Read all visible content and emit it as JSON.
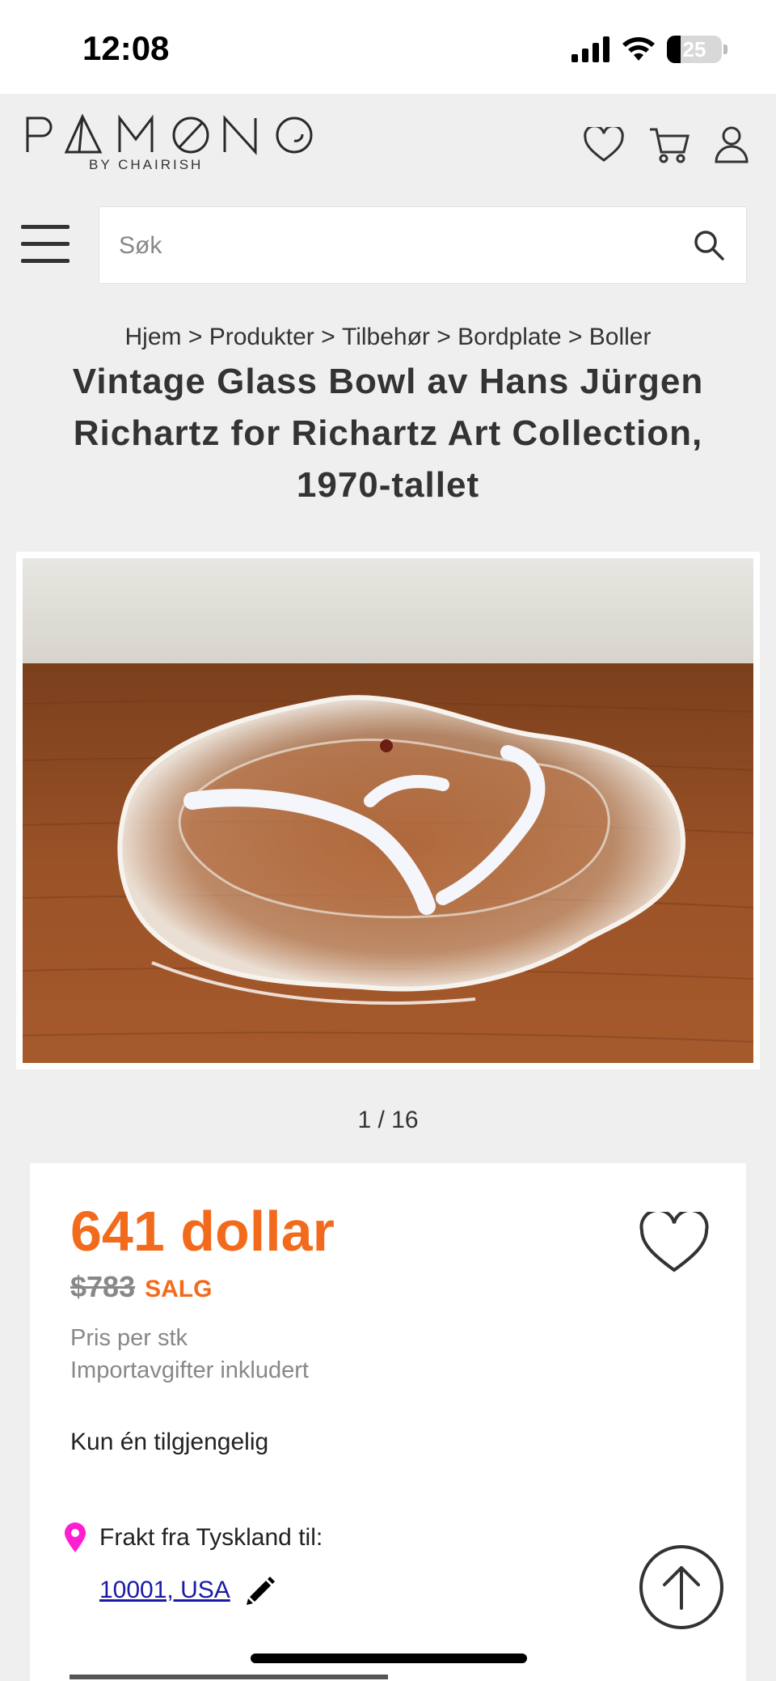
{
  "status_bar": {
    "time": "12:08",
    "battery_level": "25",
    "battery_fraction": 0.25
  },
  "header": {
    "logo_text": "PAMONO",
    "logo_subtitle": "BY CHAIRISH",
    "icons": [
      "heart-icon",
      "cart-icon",
      "user-icon"
    ]
  },
  "search": {
    "placeholder": "Søk",
    "value": ""
  },
  "breadcrumb": [
    "Hjem",
    "Produkter",
    "Tilbehør",
    "Bordplate",
    "Boller"
  ],
  "breadcrumb_separator": ">",
  "product": {
    "title": "Vintage Glass Bowl av Hans Jürgen Richartz for Richartz Art Collection, 1970-tallet",
    "image_counter": "1 / 16",
    "price": "641 dollar",
    "old_price": "$783",
    "sale_label": "SALG",
    "price_note_1": "Pris per stk",
    "price_note_2": "Importavgifter inkludert",
    "availability": "Kun én tilgjengelig",
    "shipping_label": "Frakt fra Tyskland til:",
    "shipping_destination": "10001, USA"
  },
  "colors": {
    "accent": "#f26b1d",
    "location_pin": "#ff1fd1",
    "link": "#1a1aa6",
    "background": "#efefef"
  }
}
